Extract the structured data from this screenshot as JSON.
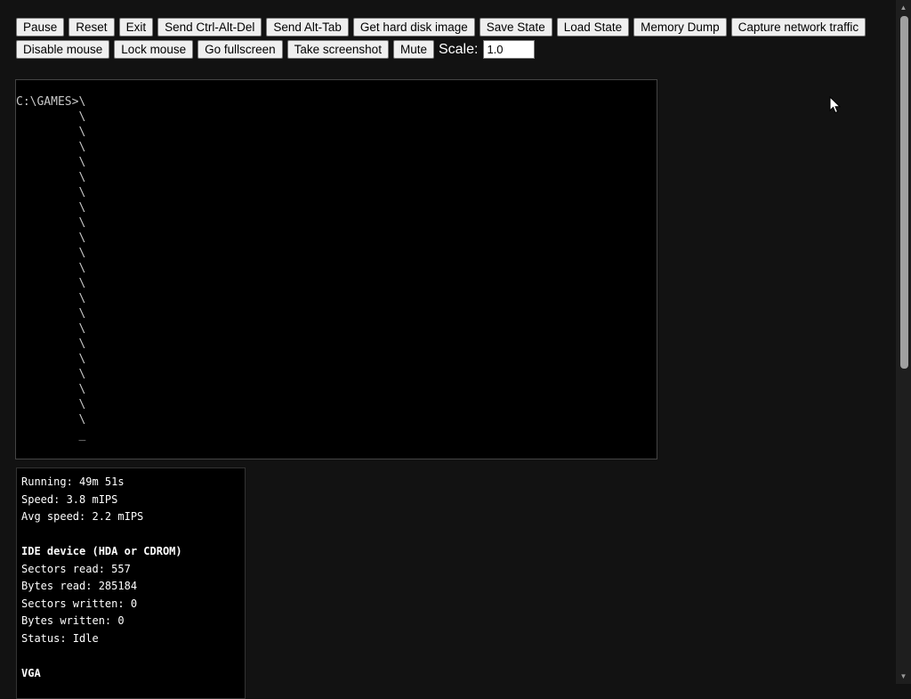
{
  "toolbar": {
    "buttons": [
      "Pause",
      "Reset",
      "Exit",
      "Send Ctrl-Alt-Del",
      "Send Alt-Tab",
      "Get hard disk image",
      "Save State",
      "Load State",
      "Memory Dump",
      "Capture network traffic",
      "Disable mouse",
      "Lock mouse",
      "Go fullscreen",
      "Take screenshot",
      "Mute"
    ],
    "scale_label": "Scale:",
    "scale_value": "1.0"
  },
  "screen": {
    "prompt": "C:\\GAMES>",
    "continuation_char": "\\",
    "continuation_count": 22,
    "cursor": "_"
  },
  "stats": {
    "running": "Running: 49m 51s",
    "speed": "Speed: 3.8 mIPS",
    "avg_speed": "Avg speed: 2.2 mIPS",
    "ide_heading": "IDE device (HDA or CDROM)",
    "sectors_read": "Sectors read: 557",
    "bytes_read": "Bytes read: 285184",
    "sectors_written": "Sectors written: 0",
    "bytes_written": "Bytes written: 0",
    "status": "Status: Idle",
    "vga_heading": "VGA"
  },
  "icons": {
    "cursor": "mouse-pointer-icon",
    "scroll_up": "scroll-up-arrow-icon",
    "scroll_down": "scroll-down-arrow-icon"
  }
}
